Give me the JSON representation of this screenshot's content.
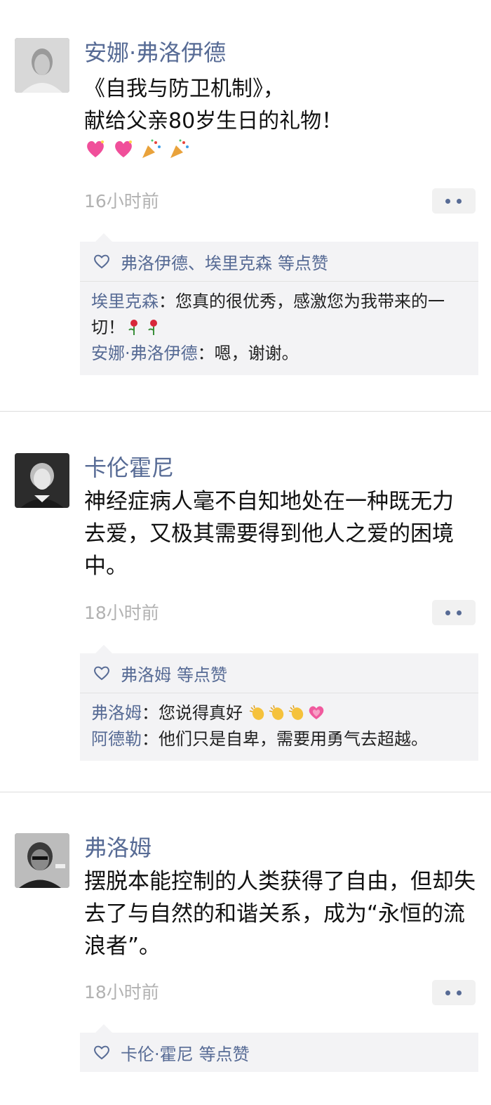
{
  "posts": [
    {
      "name": "安娜·弗洛伊德",
      "text_lines": [
        "《自我与防卫机制》，",
        "献给父亲80岁生日的礼物！"
      ],
      "emojis": [
        "sparkling-heart",
        "sparkling-heart",
        "party-popper",
        "party-popper"
      ],
      "time": "16小时前",
      "likes": "弗洛伊德、埃里克森",
      "likes_suffix": "等点赞",
      "comments": [
        {
          "who": "埃里克森",
          "sep": "：",
          "text": "您真的很优秀，感激您为我带来的一切！",
          "emojis": [
            "rose",
            "rose"
          ]
        },
        {
          "who": "安娜·弗洛伊德",
          "sep": "：",
          "text": "嗯，谢谢。",
          "emojis": []
        }
      ]
    },
    {
      "name": "卡伦霍尼",
      "text": "神经症病人毫不自知地处在一种既无力去爱，又极其需要得到他人之爱的困境中。",
      "time": "18小时前",
      "likes": "弗洛姆",
      "likes_suffix": "等点赞",
      "comments": [
        {
          "who": "弗洛姆",
          "sep": "：",
          "text": "您说得真好",
          "emojis": [
            "clapping-hands",
            "clapping-hands",
            "clapping-hands",
            "growing-heart"
          ]
        },
        {
          "who": "阿德勒",
          "sep": "：",
          "text": "他们只是自卑，需要用勇气去超越。",
          "emojis": []
        }
      ]
    },
    {
      "name": "弗洛姆",
      "text": "摆脱本能控制的人类获得了自由，但却失去了与自然的和谐关系，成为“永恒的流浪者”。",
      "time": "18小时前",
      "likes": "卡伦·霍尼",
      "likes_suffix": "等点赞",
      "comments": []
    }
  ],
  "colors": {
    "name_blue": "#576b95",
    "time_gray": "#b2b2b2",
    "interact_bg": "#f3f3f5"
  },
  "icons": {
    "like": "heart-outline-icon",
    "more": "more-dots-icon"
  }
}
